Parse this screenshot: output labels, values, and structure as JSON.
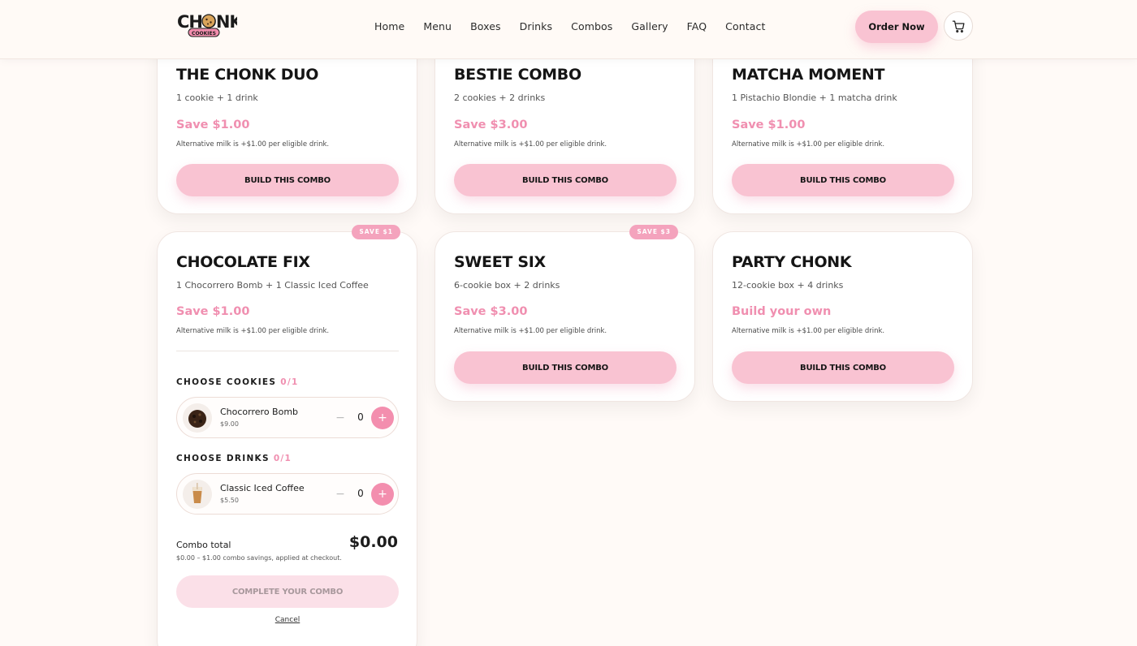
{
  "header": {
    "logo_text": "CHONK",
    "logo_sub": "COOKIES",
    "nav": [
      "Home",
      "Menu",
      "Boxes",
      "Drinks",
      "Combos",
      "Gallery",
      "FAQ",
      "Contact"
    ],
    "order_label": "Order Now"
  },
  "colors": {
    "accent": "#f9c3d2",
    "accent_text": "#f08fb0",
    "plus": "#f38eae"
  },
  "combos": [
    {
      "title": "THE CHONK DUO",
      "sub": "1 cookie + 1 drink",
      "save": "Save $1.00",
      "note": "Alternative milk is +$1.00 per eligible drink.",
      "button": "BUILD THIS COMBO"
    },
    {
      "title": "BESTIE COMBO",
      "sub": "2 cookies + 2 drinks",
      "save": "Save $3.00",
      "note": "Alternative milk is +$1.00 per eligible drink.",
      "button": "BUILD THIS COMBO"
    },
    {
      "title": "MATCHA MOMENT",
      "sub": "1 Pistachio Blondie + 1 matcha drink",
      "save": "Save $1.00",
      "note": "Alternative milk is +$1.00 per eligible drink.",
      "button": "BUILD THIS COMBO"
    },
    {
      "title": "CHOCOLATE FIX",
      "badge": "SAVE $1",
      "sub": "1 Chocorrero Bomb + 1 Classic Iced Coffee",
      "save": "Save $1.00",
      "note": "Alternative milk is +$1.00 per eligible drink."
    },
    {
      "title": "SWEET SIX",
      "badge": "SAVE $3",
      "sub": "6-cookie box + 2 drinks",
      "save": "Save $3.00",
      "note": "Alternative milk is +$1.00 per eligible drink.",
      "button": "BUILD THIS COMBO"
    },
    {
      "title": "PARTY CHONK",
      "sub": "12-cookie box + 4 drinks",
      "save": "Build your own",
      "note": "Alternative milk is +$1.00 per eligible drink.",
      "button": "BUILD THIS COMBO"
    }
  ],
  "builder": {
    "cookies_label": "CHOOSE COOKIES",
    "cookies_count": "0/1",
    "cookie": {
      "name": "Chocorrero Bomb",
      "price": "$9.00",
      "qty": "0",
      "minus": "−",
      "plus": "+"
    },
    "drinks_label": "CHOOSE DRINKS",
    "drinks_count": "0/1",
    "drink": {
      "name": "Classic Iced Coffee",
      "price": "$5.50",
      "qty": "0",
      "minus": "−",
      "plus": "+"
    },
    "total_label": "Combo total",
    "total_value": "$0.00",
    "total_note": "$0.00 – $1.00 combo savings, applied at checkout.",
    "complete_label": "COMPLETE YOUR COMBO",
    "cancel_label": "Cancel"
  }
}
